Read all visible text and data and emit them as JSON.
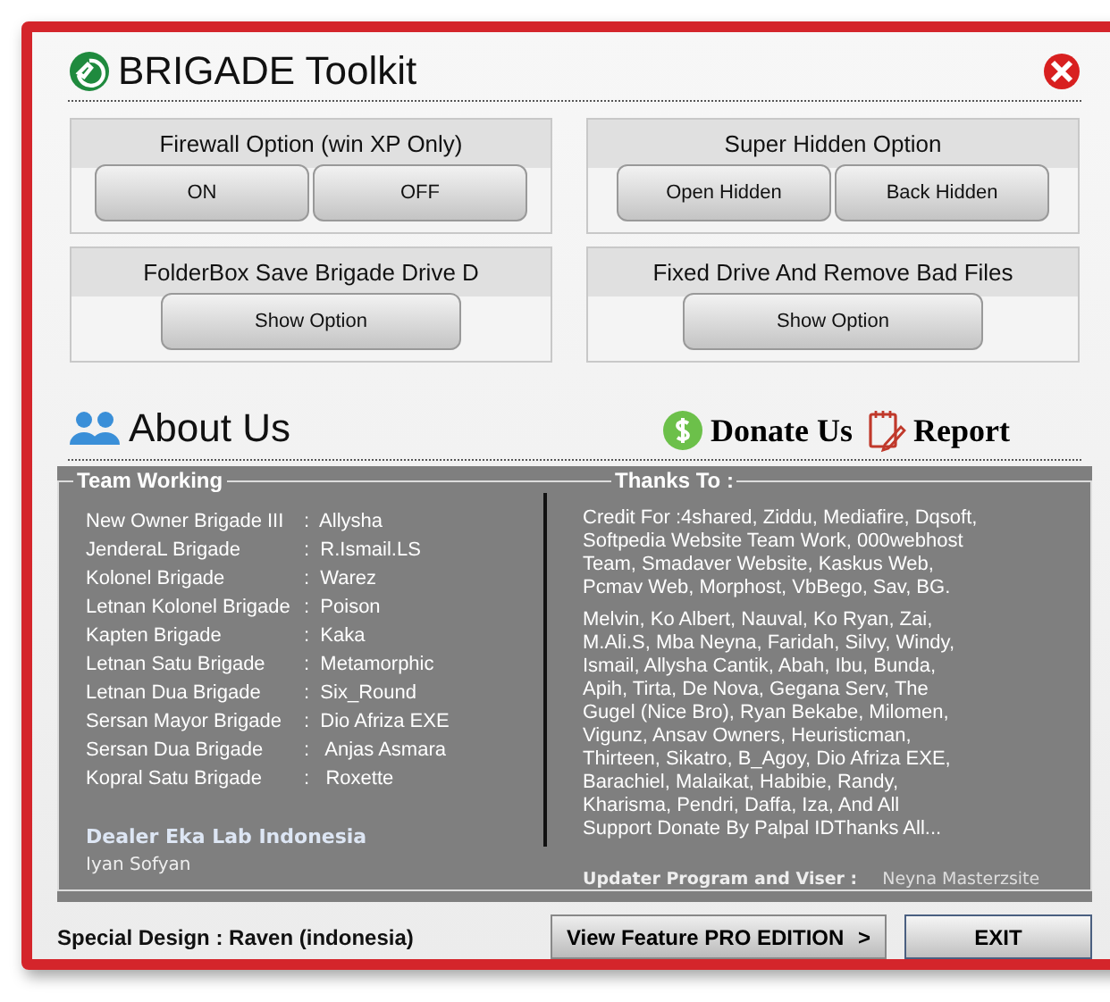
{
  "window": {
    "title": "BRIGADE Toolkit"
  },
  "panels": [
    {
      "title": "Firewall Option (win XP Only)",
      "buttons": [
        "ON",
        "OFF"
      ]
    },
    {
      "title": "Super Hidden Option",
      "buttons": [
        "Open Hidden",
        "Back Hidden"
      ]
    },
    {
      "title": "FolderBox Save Brigade Drive D",
      "buttons": [
        "Show Option"
      ]
    },
    {
      "title": "Fixed Drive And Remove Bad Files",
      "buttons": [
        "Show Option"
      ]
    }
  ],
  "about": {
    "title": "About Us",
    "donate": "Donate Us",
    "report": "Report"
  },
  "team": {
    "legend": "Team Working",
    "rows": [
      {
        "role": "New Owner Brigade III",
        "name": ":  Allysha"
      },
      {
        "role": "JenderaL Brigade",
        "name": ":  R.Ismail.LS"
      },
      {
        "role": "Kolonel Brigade",
        "name": ":  Warez"
      },
      {
        "role": "Letnan Kolonel Brigade",
        "name": ":  Poison"
      },
      {
        "role": "Kapten Brigade",
        "name": ":  Kaka"
      },
      {
        "role": "Letnan Satu Brigade",
        "name": ":  Metamorphic"
      },
      {
        "role": "Letnan Dua Brigade",
        "name": ":  Six_Round"
      },
      {
        "role": "Sersan Mayor Brigade",
        "name": ":  Dio Afriza EXE"
      },
      {
        "role": "Sersan Dua  Brigade",
        "name": ":   Anjas Asmara"
      },
      {
        "role": "Kopral Satu Brigade",
        "name": ":   Roxette"
      }
    ],
    "dealer": "Dealer Eka Lab Indonesia",
    "dealer_name": "Iyan Sofyan"
  },
  "thanks": {
    "legend": "Thanks To :",
    "paragraphs": [
      [
        "Credit For :4shared, Ziddu, Mediafire, Dqsoft,",
        "Softpedia Website Team Work, 000webhost",
        "Team, Smadaver Website, Kaskus Web,",
        "Pcmav Web, Morphost, VbBego, Sav, BG."
      ],
      [
        "Melvin, Ko Albert, Nauval, Ko Ryan, Zai,",
        "M.Ali.S, Mba Neyna, Faridah, Silvy, Windy,",
        "Ismail, Allysha Cantik, Abah, Ibu, Bunda,",
        "Apih, Tirta, De Nova, Gegana Serv, The",
        "Gugel (Nice Bro), Ryan Bekabe, Milomen,",
        "Vigunz, Ansav Owners, Heuristicman,",
        "Thirteen, Sikatro, B_Agoy, Dio Afriza EXE,",
        "Barachiel, Malaikat, Habibie, Randy,",
        "Kharisma, Pendri, Daffa, Iza,  And All",
        "Support Donate By Palpal IDThanks All..."
      ]
    ],
    "updater_label": "Updater Program and Viser :",
    "updater_name": "Neyna Masterzsite"
  },
  "footer": {
    "credit": "Special Design : Raven (indonesia)",
    "pro_button": "View Feature PRO EDITION",
    "pro_arrow": ">",
    "exit_button": "EXIT"
  }
}
